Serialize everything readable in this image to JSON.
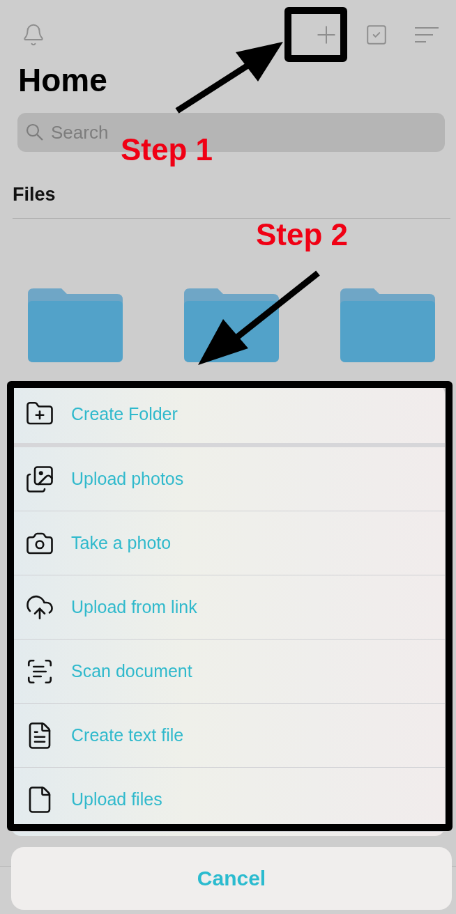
{
  "toolbar": [
    {
      "kind": "bell"
    },
    {
      "kind": "plus"
    },
    {
      "kind": "select"
    },
    {
      "kind": "sort"
    }
  ],
  "header": {
    "title": "Home",
    "search": {
      "placeholder": "Search"
    }
  },
  "section": {
    "title": "Files"
  },
  "folders": [
    {
      "kind": "folder"
    },
    {
      "kind": "folder"
    },
    {
      "kind": "folder"
    }
  ],
  "action_sheet": {
    "items": [
      {
        "kind": "create-folder",
        "label": "Create Folder"
      },
      {
        "kind": "upload-photos",
        "label": "Upload photos"
      },
      {
        "kind": "camera",
        "label": "Take a photo"
      },
      {
        "kind": "link",
        "label": "Upload from link"
      },
      {
        "kind": "scan",
        "label": "Scan document"
      },
      {
        "kind": "text-file",
        "label": "Create text file"
      },
      {
        "kind": "file",
        "label": "Upload files"
      }
    ],
    "cancel": "Cancel"
  },
  "annotations": [
    {
      "kind": "step1",
      "label": "Step 1"
    },
    {
      "kind": "step2",
      "label": "Step 2"
    }
  ]
}
